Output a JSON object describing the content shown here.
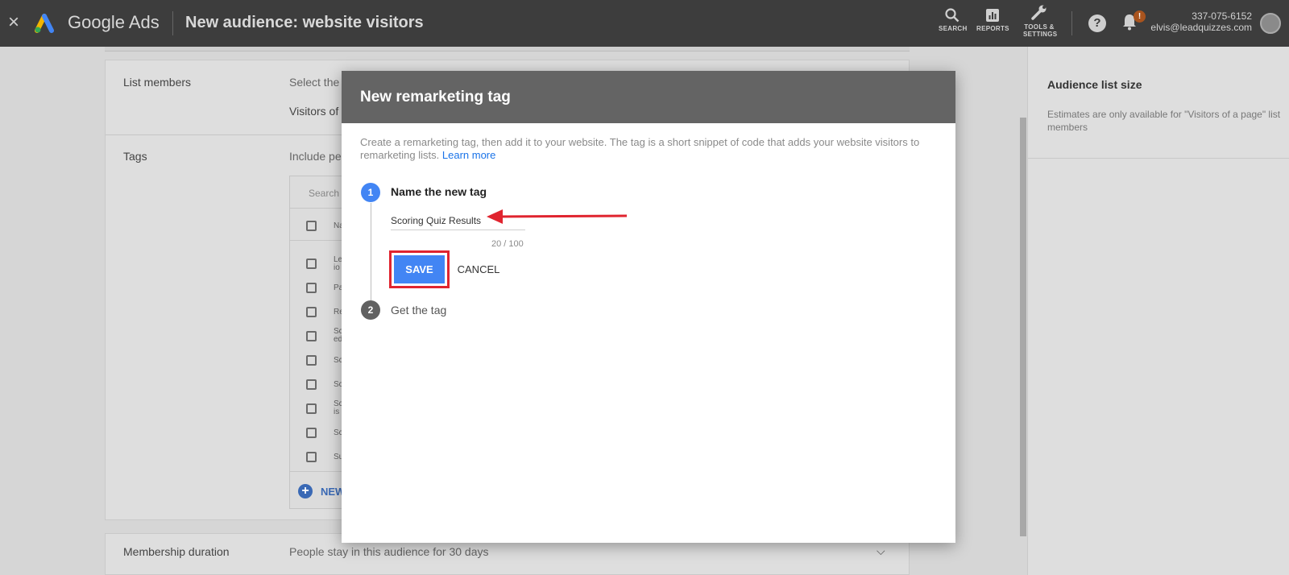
{
  "topbar": {
    "close_glyph": "×",
    "brand": "Google Ads",
    "title": "New audience: website visitors",
    "tools": {
      "search": "SEARCH",
      "reports": "REPORTS",
      "tools_line1": "TOOLS &",
      "tools_line2": "SETTINGS"
    },
    "help_glyph": "?",
    "notification_badge": "!",
    "account_phone": "337-075-6152",
    "account_email": "elvis@leadquizzes.com"
  },
  "background": {
    "list_members_label": "List members",
    "list_members_text": "Select the",
    "visitors_text": "Visitors of",
    "tags_label": "Tags",
    "tags_text": "Include pe",
    "search_placeholder": "Search",
    "tag_rows": [
      {
        "text": "Na"
      },
      {
        "text": "Le io"
      },
      {
        "text": "Pa"
      },
      {
        "text": "Re"
      },
      {
        "text": "Sc ed"
      },
      {
        "text": "Sc"
      },
      {
        "text": "Sc"
      },
      {
        "text": "Sc is"
      },
      {
        "text": "Sc"
      },
      {
        "text": "Su"
      }
    ],
    "new_label": "NEW",
    "membership_label": "Membership duration",
    "membership_text": "People stay in this audience for 30 days"
  },
  "right_panel": {
    "title": "Audience list size",
    "text": "Estimates are only available for \"Visitors of a page\" list members"
  },
  "dialog": {
    "title": "New remarketing tag",
    "intro": "Create a remarketing tag, then add it to your website. The tag is a short snippet of code that adds your website visitors to remarketing lists.",
    "learn_more": "Learn more",
    "step1_num": "1",
    "step1_label": "Name the new tag",
    "tag_name_value": "Scoring Quiz Results",
    "counter": "20 / 100",
    "save_label": "SAVE",
    "cancel_label": "CANCEL",
    "step2_num": "2",
    "step2_label": "Get the tag"
  },
  "colors": {
    "primary": "#4285f4",
    "highlight": "#e0242f",
    "header": "#3d3d3d"
  }
}
